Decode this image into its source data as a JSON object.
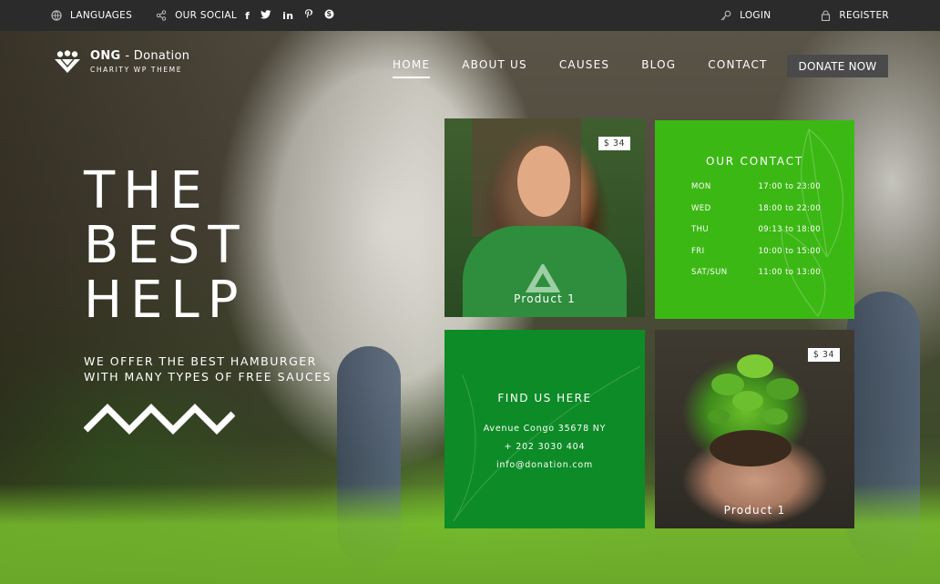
{
  "topbar": {
    "languages_label": "LANGUAGES",
    "social_label": "OUR SOCIAL",
    "social_icons": [
      "facebook-icon",
      "twitter-icon",
      "linkedin-icon",
      "pinterest-icon",
      "skype-icon"
    ],
    "login_label": "LOGIN",
    "register_label": "REGISTER"
  },
  "logo": {
    "name": "ONG",
    "name_suffix": "- Donation",
    "tagline": "CHARITY WP THEME"
  },
  "nav": {
    "items": [
      "HOME",
      "ABOUT US",
      "CAUSES",
      "BLOG",
      "CONTACT"
    ],
    "active": "HOME",
    "donate_label": "DONATE NOW"
  },
  "hero": {
    "title_lines": [
      "THE",
      "BEST",
      "HELP"
    ],
    "subtitle_lines": [
      "WE OFFER THE BEST HAMBURGER",
      "WITH MANY TYPES OF FREE SAUCES"
    ]
  },
  "cards": {
    "product_girl": {
      "price": "$ 34",
      "label": "Product 1"
    },
    "product_plant": {
      "price": "$ 34",
      "label": "Product 1"
    },
    "contact": {
      "title": "OUR CONTACT",
      "hours": [
        {
          "day": "MON",
          "time": "17:00 to 23:00"
        },
        {
          "day": "WED",
          "time": "18:00 to 22:00"
        },
        {
          "day": "THU",
          "time": "09:13 to 18:00"
        },
        {
          "day": "FRI",
          "time": "10:00 to 15:00"
        },
        {
          "day": "SAT/SUN",
          "time": "11:00 to 13:00"
        }
      ]
    },
    "find": {
      "title": "FIND US HERE",
      "address": "Avenue Congo 35678 NY",
      "phone": "+ 202 3030 404",
      "email": "info@donation.com"
    }
  },
  "colors": {
    "topbar": "#2b2b2b",
    "contact_green": "#3cb815",
    "find_green": "#0d8b27",
    "donate_bg": "#4a4a4a"
  }
}
